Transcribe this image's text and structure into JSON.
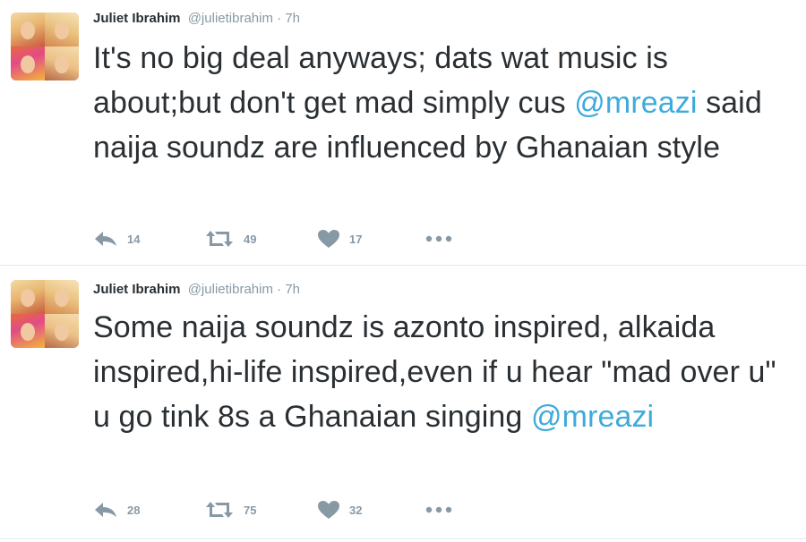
{
  "colors": {
    "text": "#292f33",
    "meta": "#8899a6",
    "mention": "#3faadc",
    "divider": "#e1e8ed"
  },
  "tweets": [
    {
      "author": "Juliet Ibrahim",
      "handle": "@julietibrahim",
      "separator": "·",
      "time": "7h",
      "text_before": "It's no big deal anyways; dats wat music is about;but don't get mad simply cus ",
      "mention": "@mreazi",
      "text_after": " said naija soundz are influenced by Ghanaian style",
      "replies": "14",
      "retweets": "49",
      "likes": "17",
      "icons": [
        "reply-icon",
        "retweet-icon",
        "heart-icon",
        "more-icon"
      ]
    },
    {
      "author": "Juliet Ibrahim",
      "handle": "@julietibrahim",
      "separator": "·",
      "time": "7h",
      "text_before": "Some naija soundz is azonto inspired, alkaida inspired,hi-life inspired,even if u hear \"mad over u\" u go tink 8s a Ghanaian singing ",
      "mention": "@mreazi",
      "text_after": "",
      "replies": "28",
      "retweets": "75",
      "likes": "32",
      "icons": [
        "reply-icon",
        "retweet-icon",
        "heart-icon",
        "more-icon"
      ]
    }
  ]
}
